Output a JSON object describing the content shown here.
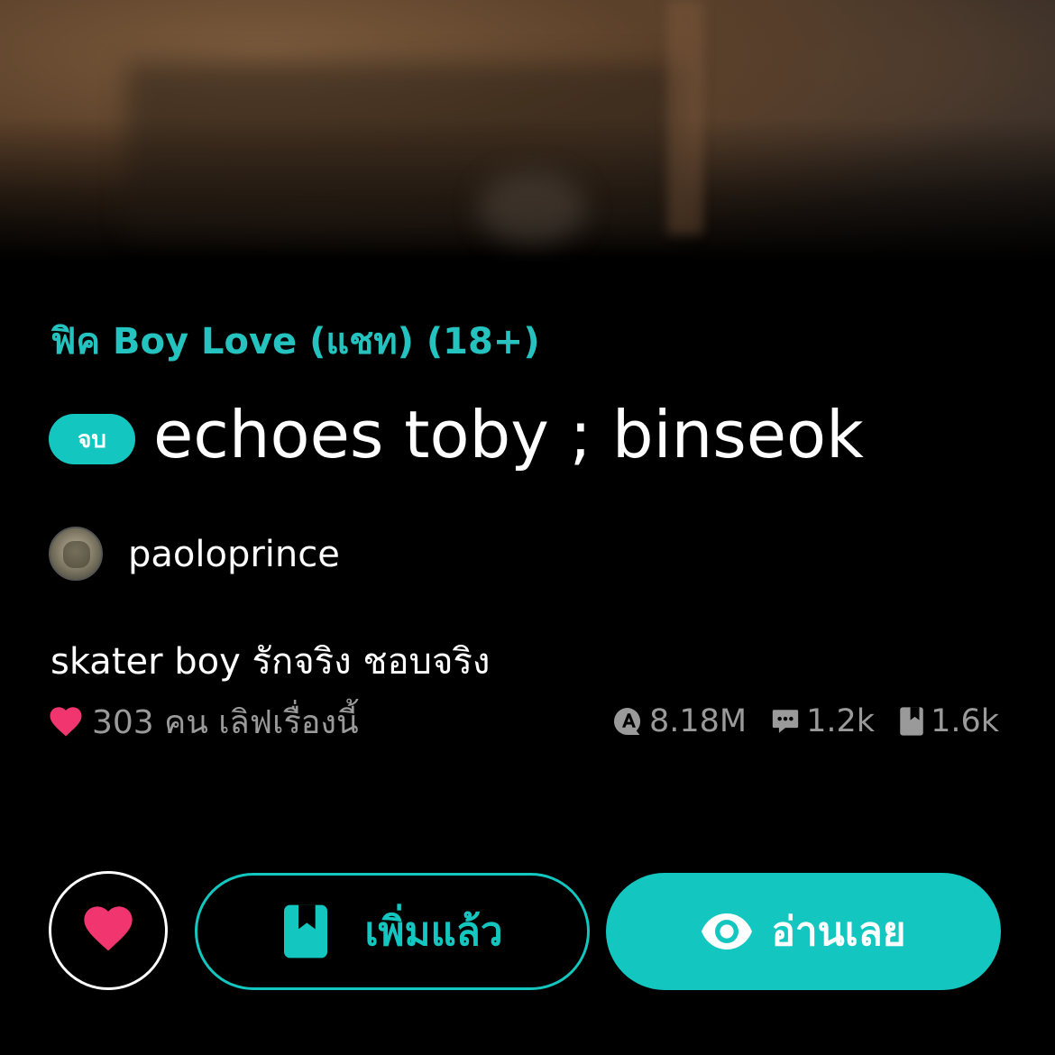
{
  "story": {
    "category": "ฟิค Boy Love (แชท) (18+)",
    "status_badge": "จบ",
    "title": "echoes toby ; binseok",
    "author": "paoloprince",
    "description": "skater boy รักจริง ชอบจริง",
    "love_text": "303 คน เลิฟเรื่องนี้"
  },
  "stats": {
    "views": "8.18M",
    "comments": "1.2k",
    "library_adds": "1.6k"
  },
  "actions": {
    "library_label": "เพิ่มแล้ว",
    "read_label": "อ่านเลย"
  },
  "colors": {
    "accent": "#13c6c0",
    "heart": "#f0356f",
    "muted_text": "#9a9a9a",
    "background": "#000000"
  }
}
